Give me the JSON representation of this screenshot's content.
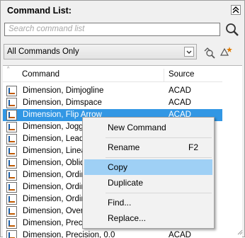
{
  "panel": {
    "title": "Command List:"
  },
  "search": {
    "placeholder": "Search command list"
  },
  "filter": {
    "selected": "All Commands Only"
  },
  "columns": {
    "command": "Command",
    "source": "Source"
  },
  "rows": [
    {
      "name": "Dimension, Dimjogline",
      "source": "ACAD"
    },
    {
      "name": "Dimension, Dimspace",
      "source": "ACAD"
    },
    {
      "name": "Dimension, Flip Arrow",
      "source": "ACAD"
    },
    {
      "name": "Dimension, Jogge",
      "source": ""
    },
    {
      "name": "Dimension, Leade",
      "source": ""
    },
    {
      "name": "Dimension, Linear",
      "source": ""
    },
    {
      "name": "Dimension, Obliqu",
      "source": ""
    },
    {
      "name": "Dimension, Ordina",
      "source": ""
    },
    {
      "name": "Dimension, Ordina",
      "source": ""
    },
    {
      "name": "Dimension, Ordina",
      "source": ""
    },
    {
      "name": "Dimension, Overric",
      "source": ""
    },
    {
      "name": "Dimension, Precisi",
      "source": ""
    },
    {
      "name": "Dimension, Precision, 0.0",
      "source": "ACAD"
    }
  ],
  "context_menu": {
    "new_command": "New Command",
    "rename": "Rename",
    "rename_shortcut": "F2",
    "copy": "Copy",
    "duplicate": "Duplicate",
    "find": "Find...",
    "replace": "Replace..."
  },
  "colors": {
    "selection": "#3297e4",
    "menu_highlight": "#9fd0f5"
  }
}
